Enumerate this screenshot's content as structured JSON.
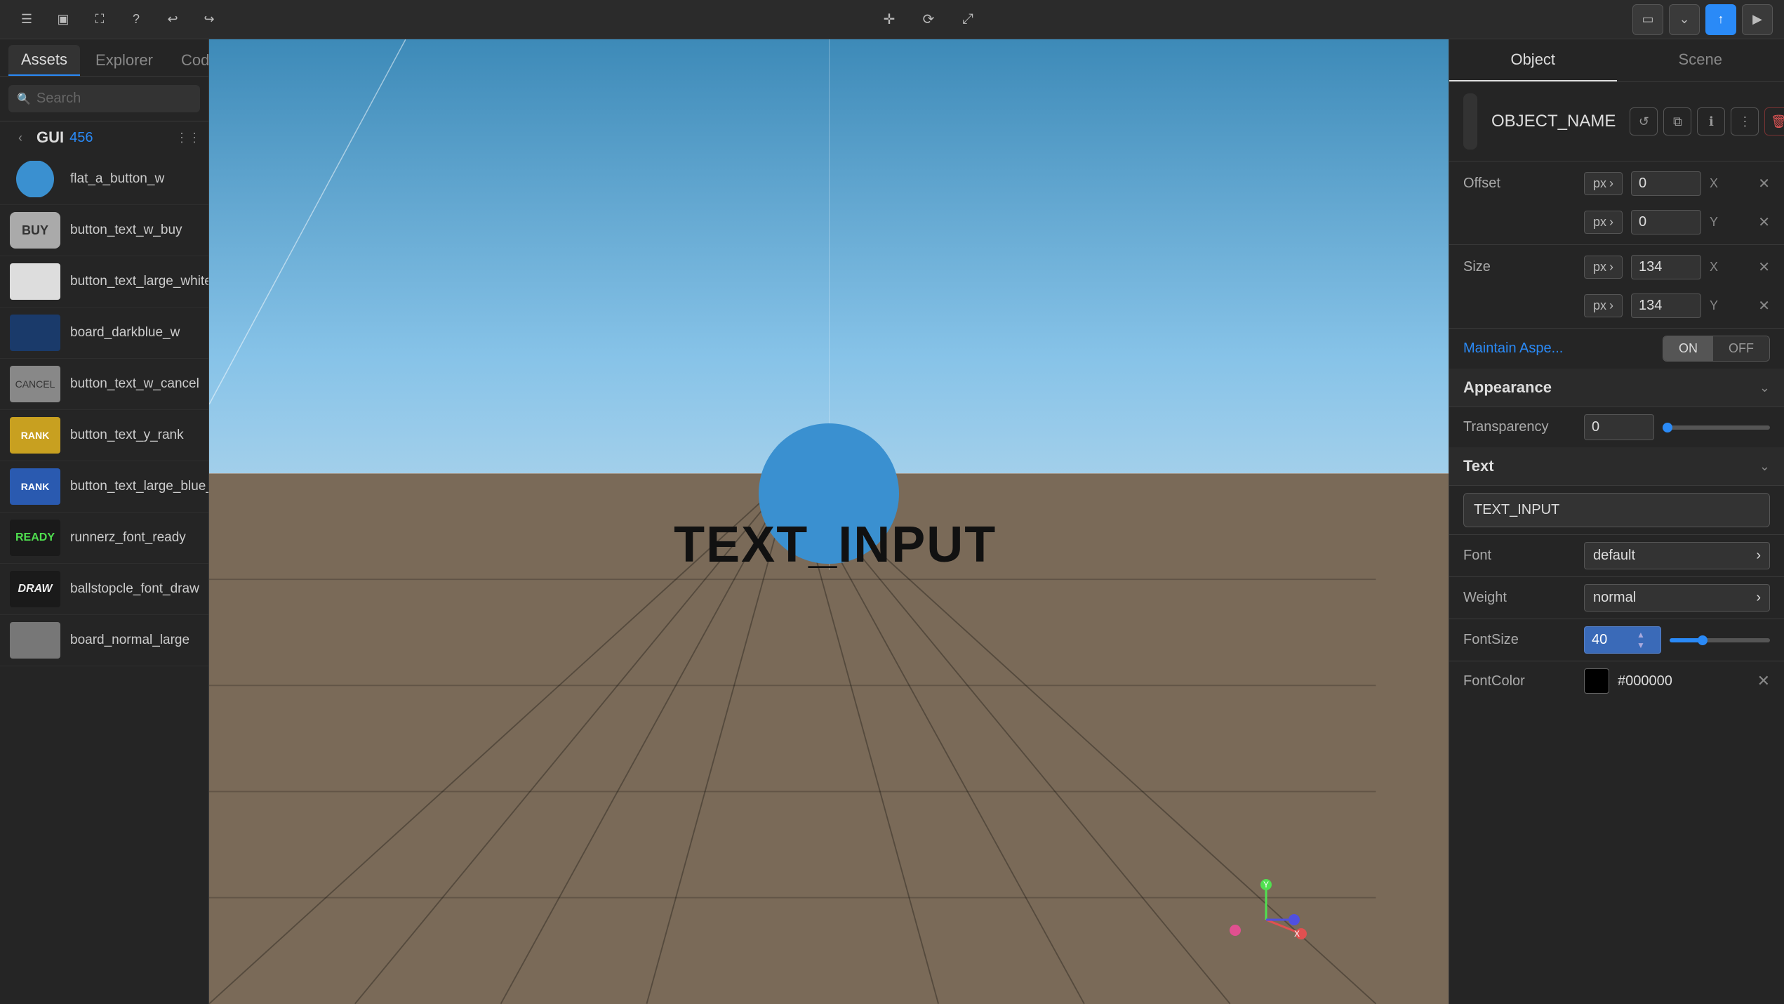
{
  "toolbar": {
    "left_buttons": [
      {
        "name": "menu-icon",
        "label": "☰"
      },
      {
        "name": "layout-icon",
        "label": "▣"
      },
      {
        "name": "fullscreen-icon",
        "label": "⛶"
      },
      {
        "name": "help-icon",
        "label": "?"
      },
      {
        "name": "undo-icon",
        "label": "↩"
      },
      {
        "name": "redo-icon",
        "label": "↪"
      }
    ],
    "center_buttons": [
      {
        "name": "move-icon",
        "label": "✛"
      },
      {
        "name": "refresh-icon",
        "label": "⟳"
      },
      {
        "name": "expand-icon",
        "label": "⤢"
      }
    ],
    "right_buttons": [
      {
        "name": "panel-icon",
        "label": "▭"
      },
      {
        "name": "chevron-down-icon",
        "label": "⌄"
      },
      {
        "name": "upload-icon",
        "label": "↑"
      },
      {
        "name": "play-icon",
        "label": "▶"
      }
    ]
  },
  "left_panel": {
    "tabs": [
      {
        "name": "assets-tab",
        "label": "Assets"
      },
      {
        "name": "explorer-tab",
        "label": "Explorer"
      },
      {
        "name": "code-tab",
        "label": "Code"
      }
    ],
    "search": {
      "placeholder": "Search"
    },
    "category": {
      "name": "GUI",
      "count": "456"
    },
    "assets": [
      {
        "name": "flat_a_button_w",
        "thumb_type": "circle-blue"
      },
      {
        "name": "button_text_w_buy",
        "thumb_type": "buy-button"
      },
      {
        "name": "button_text_large_white_null",
        "thumb_type": "white-bar"
      },
      {
        "name": "board_darkblue_w",
        "thumb_type": "darkblue-bar"
      },
      {
        "name": "button_text_w_cancel",
        "thumb_type": "cancel-button"
      },
      {
        "name": "button_text_y_rank",
        "thumb_type": "rank-button-y"
      },
      {
        "name": "button_text_large_blue_rank",
        "thumb_type": "rank-button-b"
      },
      {
        "name": "runnerz_font_ready",
        "thumb_type": "ready-text"
      },
      {
        "name": "ballstopcle_font_draw",
        "thumb_type": "draw-text"
      },
      {
        "name": "board_normal_large",
        "thumb_type": "board-normal"
      }
    ]
  },
  "canvas": {
    "text_label": "TEXT_INPUT"
  },
  "right_panel": {
    "tabs": [
      {
        "name": "object-tab",
        "label": "Object"
      },
      {
        "name": "scene-tab",
        "label": "Scene"
      }
    ],
    "object_name": "OBJECT_NAME",
    "offset": {
      "label": "Offset",
      "x_unit": "px",
      "x_value": "0",
      "x_coord": "X",
      "y_unit": "px",
      "y_value": "0",
      "y_coord": "Y"
    },
    "size": {
      "label": "Size",
      "x_unit": "px",
      "x_value": "134",
      "x_coord": "X",
      "y_unit": "px",
      "y_value": "134",
      "y_coord": "Y"
    },
    "maintain_aspect": {
      "label": "Maintain Aspe...",
      "on_label": "ON",
      "off_label": "OFF",
      "active": "ON"
    },
    "appearance": {
      "section_label": "Appearance",
      "transparency": {
        "label": "Transparency",
        "value": "0"
      }
    },
    "text": {
      "section_label": "Text",
      "input_value": "TEXT_INPUT",
      "font": {
        "label": "Font",
        "value": "default"
      },
      "weight": {
        "label": "Weight",
        "value": "normal"
      },
      "font_size": {
        "label": "FontSize",
        "value": "40"
      },
      "font_color": {
        "label": "FontColor",
        "value": "#000000",
        "swatch": "#000000"
      }
    }
  }
}
